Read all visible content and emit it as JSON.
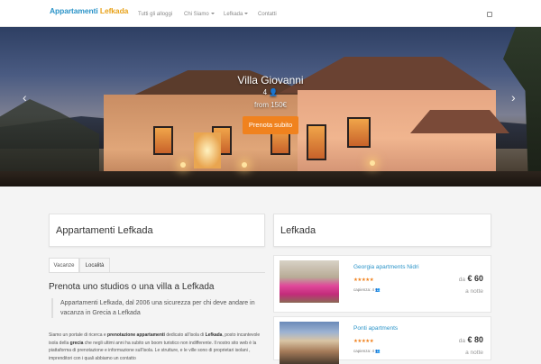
{
  "brand": {
    "part1": "Appartamenti",
    "part2": "Lefkada",
    "color1": "#2a93c8",
    "color2": "#e8a21a"
  },
  "nav": {
    "items": [
      {
        "label": "Tutti gli alloggi",
        "caret": false
      },
      {
        "label": "Chi Siamo",
        "caret": true
      },
      {
        "label": "Lefkada",
        "caret": true
      },
      {
        "label": "Contatti",
        "caret": false
      }
    ],
    "login_icon": "sign-in-icon"
  },
  "hero": {
    "title": "Villa Giovanni",
    "subtitle": "4",
    "subtitle_icon": "user-icon",
    "price": "from 150€",
    "button": "Prenota subito",
    "accent": "#f0821e"
  },
  "left": {
    "panel_title": "Appartamenti Lefkada",
    "tabs": [
      "Vacanze",
      "Località"
    ],
    "active_tab": "Vacanze",
    "heading": "Prenota uno studios o una villa a Lefkada",
    "quote": "Appartamenti Lefkada, dal 2006 una sicurezza per chi deve andare in vacanza in Grecia a Lefkada",
    "body_1": "Siamo un portale di ricerca e",
    "body_bold_1": "prenotazione appartamenti",
    "body_2": "dedicato all'isola di",
    "body_bold_2": "Lefkada",
    "body_3": ", posto incantevole isola della",
    "body_bold_3": "grecia",
    "body_4": "che negli ultimi anni ha subito un boom turistico non indifferente. Il nostro sito web è la piattaforma di prenotazione e informazione sull'isola. Le strutture, e le ville sono di proprietari isolani , imprenditori con i quali abbiamo un contatto"
  },
  "right": {
    "panel_title": "Lefkada",
    "listings": [
      {
        "title": "Georgia apartments Nidri",
        "rating": 5,
        "stars": "★★★★★",
        "capacity_label": "capienza: 4",
        "capacity_icon": "users-icon",
        "price_prefix": "da",
        "price": "€ 60",
        "per": "a notte"
      },
      {
        "title": "Ponti apartments",
        "rating": 5,
        "stars": "★★★★★",
        "capacity_label": "capienza: 4",
        "capacity_icon": "users-icon",
        "price_prefix": "da",
        "price": "€ 80",
        "per": "a notte"
      }
    ]
  }
}
